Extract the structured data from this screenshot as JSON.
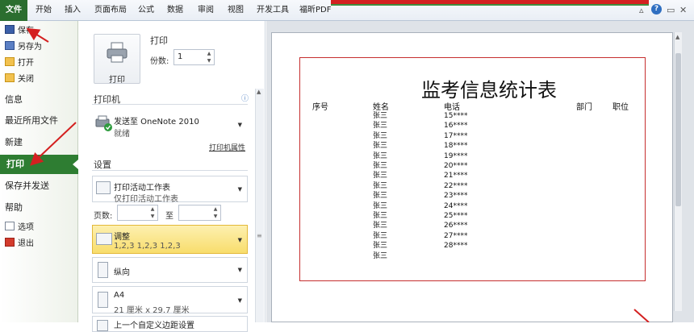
{
  "ribbon": {
    "tabs": [
      "文件",
      "开始",
      "插入",
      "页面布局",
      "公式",
      "数据",
      "审阅",
      "视图",
      "开发工具",
      "福昕PDF"
    ]
  },
  "left_menu": {
    "small_items_top": [
      "保存",
      "另存为",
      "打开",
      "关闭"
    ],
    "big_items": [
      "信息",
      "最近所用文件",
      "新建",
      "打印",
      "保存并发送",
      "帮助"
    ],
    "small_items_bottom": [
      "选项",
      "退出"
    ]
  },
  "print_panel": {
    "print_button": "打印",
    "header": "打印",
    "copies_label": "份数:",
    "copies_value": "1",
    "printer_section": "打印机",
    "printer_name": "发送至 OneNote 2010",
    "printer_status": "就绪",
    "printer_properties": "打印机属性",
    "settings_section": "设置",
    "print_what": "打印活动工作表",
    "print_what_desc": "仅打印活动工作表",
    "pages_label": "页数:",
    "pages_to": "至",
    "collate": "调整",
    "collate_desc": "1,2,3    1,2,3    1,2,3",
    "orientation": "纵向",
    "paper": "A4",
    "paper_desc": "21 厘米 x 29.7 厘米",
    "margins": "上一个自定义边距设置"
  },
  "sheet": {
    "title": "监考信息统计表",
    "headers": [
      "序号",
      "姓名",
      "电话",
      "部门",
      "职位"
    ],
    "names": [
      "张三",
      "张三",
      "张三",
      "张三",
      "张三",
      "张三",
      "张三",
      "张三",
      "张三",
      "张三",
      "张三",
      "张三",
      "张三",
      "张三",
      "张三"
    ],
    "phones": [
      "15****",
      "16****",
      "17****",
      "18****",
      "19****",
      "20****",
      "21****",
      "22****",
      "23****",
      "24****",
      "25****",
      "26****",
      "27****",
      "28****"
    ]
  },
  "colors": {
    "file_tab": "#2b6e2f",
    "print_selected": "#2e7d32",
    "annotation_red": "#d42020",
    "collate_highlight": "#f8dd6c"
  }
}
